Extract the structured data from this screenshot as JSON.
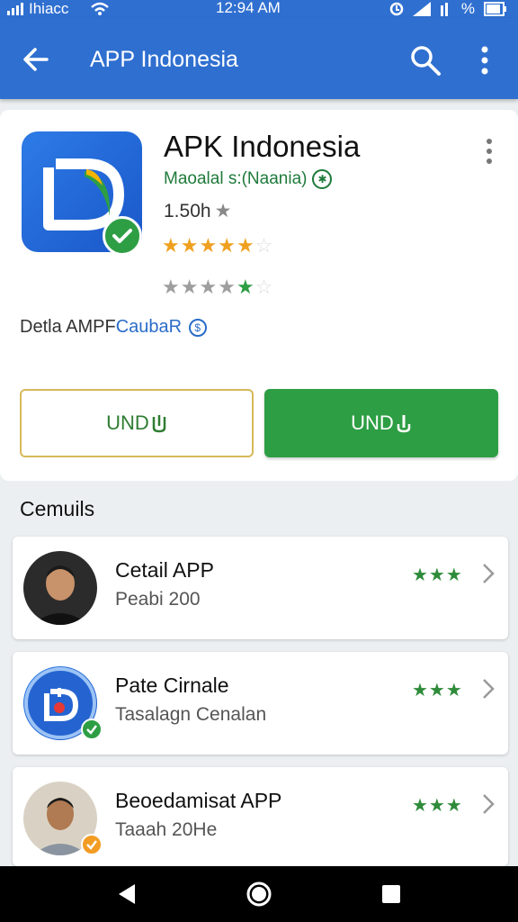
{
  "status_bar": {
    "carrier": "Ihiacc",
    "time": "12:94 AM",
    "battery": "%"
  },
  "app_bar": {
    "title": "APP Indonesia"
  },
  "app": {
    "name": "APK Indonesia",
    "developer": "Maoalal s:(Naania)",
    "size": "1.50h",
    "rating_stars": 5,
    "rating_stars_second": 5,
    "detail_prefix": "Detla AMPF",
    "detail_link": "CaubaR"
  },
  "buttons": {
    "outline_label": "UND",
    "solid_label": "UND"
  },
  "section": {
    "title": "Cemuils"
  },
  "list": [
    {
      "title": "Cetail APP",
      "subtitle": "Peabi 200",
      "rating": "★★★"
    },
    {
      "title": "Pate Cirnale",
      "subtitle": "Tasalagn Cenalan",
      "rating": "★★★"
    },
    {
      "title": "Beoedamisat APP",
      "subtitle": "Taaah 20He",
      "rating": "★★★"
    }
  ],
  "colors": {
    "primary": "#2f6fd0",
    "green": "#2e9e44",
    "star_orange": "#f0a020",
    "star_gray": "#9e9e9e"
  }
}
